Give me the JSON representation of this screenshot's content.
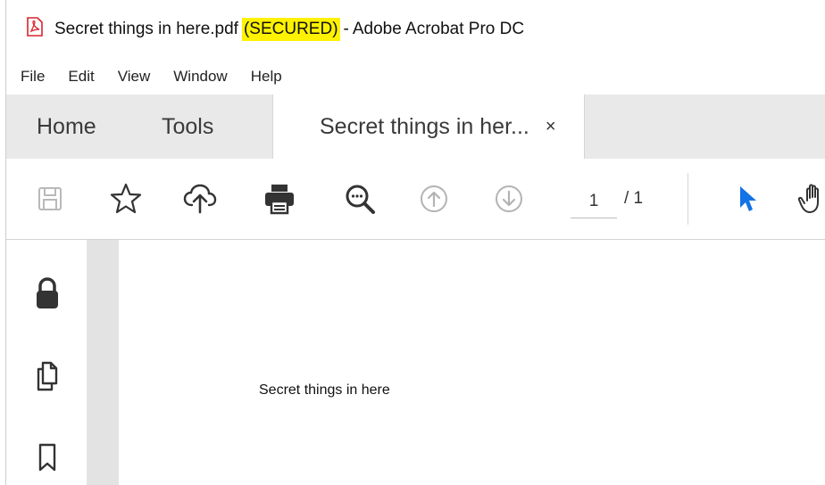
{
  "window": {
    "title_filename": "Secret things in here.pdf",
    "title_secured": "(SECURED)",
    "title_sep": "-",
    "title_app": "Adobe Acrobat Pro DC"
  },
  "menu": [
    "File",
    "Edit",
    "View",
    "Window",
    "Help"
  ],
  "tabs": {
    "home": "Home",
    "tools": "Tools",
    "document": "Secret things in her...",
    "close_glyph": "×"
  },
  "toolbar": {
    "page_current": "1",
    "page_total": "/ 1",
    "icons": [
      "save-icon",
      "bookmark-star-icon",
      "upload-cloud-icon",
      "print-icon",
      "zoom-search-icon",
      "page-up-icon",
      "page-down-icon",
      "select-cursor-icon",
      "hand-tool-icon"
    ]
  },
  "left_panel": {
    "icons": [
      "lock-icon",
      "pages-icon",
      "bookmark-icon"
    ]
  },
  "document": {
    "text": "Secret things in here"
  },
  "colors": {
    "highlight": "#fff200",
    "accent_blue": "#1473e6",
    "pdf_red": "#d9242b"
  }
}
